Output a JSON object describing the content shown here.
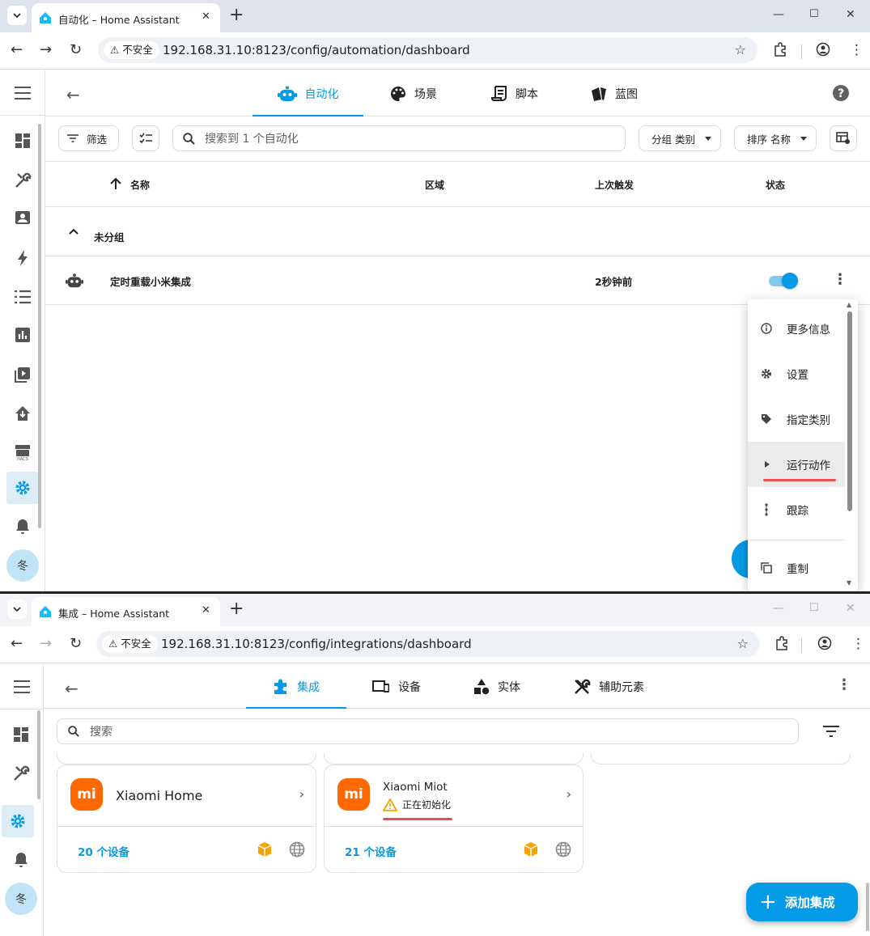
{
  "window1": {
    "tab_title": "自动化 – Home Assistant",
    "security_label": "不安全",
    "url": "192.168.31.10:8123/config/automation/dashboard",
    "nav_tabs": [
      {
        "label": "自动化",
        "icon": "robot-icon",
        "selected": true
      },
      {
        "label": "场景",
        "icon": "palette-icon"
      },
      {
        "label": "脚本",
        "icon": "script-icon"
      },
      {
        "label": "蓝图",
        "icon": "blueprint-icon"
      }
    ],
    "filter_label": "筛选",
    "search_placeholder": "搜索到 1 个自动化",
    "group_by_label": "分组 类别",
    "sort_label": "排序 名称",
    "columns": {
      "name": "名称",
      "area": "区域",
      "last_triggered": "上次触发",
      "state": "状态"
    },
    "group_name": "未分组",
    "row": {
      "name": "定时重载小米集成",
      "last_triggered": "2秒钟前",
      "enabled": true
    },
    "avatar_initial": "冬",
    "menu_items": [
      {
        "label": "更多信息",
        "icon": "info-icon"
      },
      {
        "label": "设置",
        "icon": "gear-icon"
      },
      {
        "label": "指定类别",
        "icon": "tag-icon"
      },
      {
        "label": "运行动作",
        "icon": "play-icon",
        "highlighted": true
      },
      {
        "label": "跟踪",
        "icon": "trace-icon"
      },
      {
        "label": "重制",
        "icon": "duplicate-icon"
      }
    ]
  },
  "window2": {
    "tab_title": "集成 – Home Assistant",
    "security_label": "不安全",
    "url": "192.168.31.10:8123/config/integrations/dashboard",
    "nav_tabs": [
      {
        "label": "集成",
        "icon": "puzzle-icon",
        "selected": true
      },
      {
        "label": "设备",
        "icon": "devices-icon"
      },
      {
        "label": "实体",
        "icon": "shapes-icon"
      },
      {
        "label": "辅助元素",
        "icon": "tools-icon"
      }
    ],
    "search_placeholder": "搜索",
    "avatar_initial": "冬",
    "cards": [
      {
        "title": "Xiaomi Home",
        "status": "",
        "devices": "20 个设备",
        "logo": "mi"
      },
      {
        "title": "Xiaomi Miot",
        "status": "正在初始化",
        "devices": "21 个设备",
        "logo": "mi"
      }
    ],
    "add_button_label": "添加集成"
  },
  "colors": {
    "accent": "#039be5",
    "mi_orange": "#ff6900",
    "annotation_red": "#ea4f52",
    "warning": "#f4a300"
  }
}
